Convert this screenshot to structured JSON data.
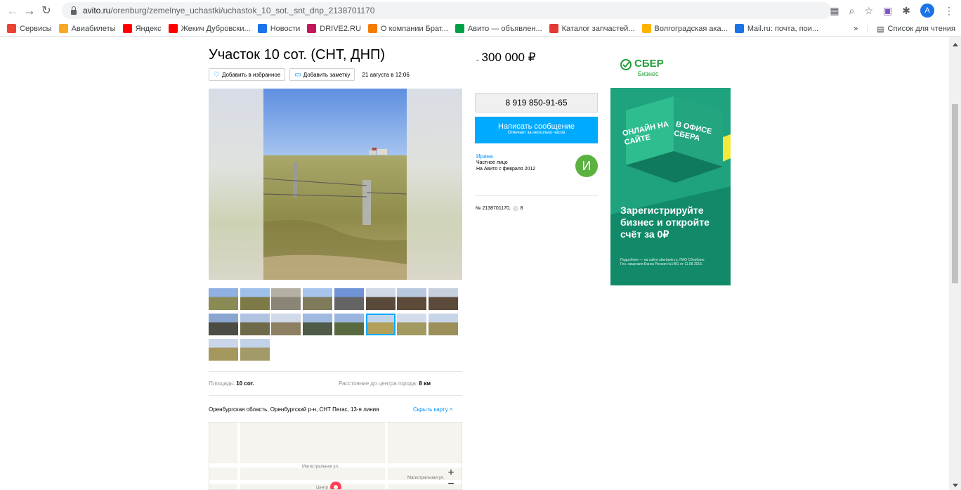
{
  "browser": {
    "url_host": "avito.ru",
    "url_path": "/orenburg/zemelnye_uchastki/uchastok_10_sot._snt_dnp_2138701170",
    "profile_initial": "A",
    "bookmarks": [
      {
        "label": "Сервисы",
        "color": "#ea4335"
      },
      {
        "label": "Авиабилеты",
        "color": "#f9a825"
      },
      {
        "label": "Яндекс",
        "color": "#ff0000"
      },
      {
        "label": "Жекич Дубровски...",
        "color": "#ff0000"
      },
      {
        "label": "Новости",
        "color": "#1a73e8"
      },
      {
        "label": "DRIVE2.RU",
        "color": "#c2185b"
      },
      {
        "label": "О компании Брат...",
        "color": "#f57c00"
      },
      {
        "label": "Авито — объявлен...",
        "color": "#00a046"
      },
      {
        "label": "Каталог запчастей...",
        "color": "#e53935"
      },
      {
        "label": "Волгоградская ака...",
        "color": "#ffb300"
      },
      {
        "label": "Mail.ru: почта, пои...",
        "color": "#1a73e8"
      }
    ],
    "bookmarks_more": "»",
    "reading_list": "Список для чтения"
  },
  "listing": {
    "title": "Участок 10 сот. (СНТ, ДНП)",
    "add_favorite": "Добавить в избранное",
    "add_note": "Добавить заметку",
    "date": "21 августа в 12:06",
    "price": "300 000 ₽",
    "phone": "8 919 850-91-65",
    "message_button": "Написать сообщение",
    "message_subtext": "Отвечает за несколько часов",
    "seller_name": "Ирина",
    "seller_type": "Частное лицо",
    "seller_since": "На Авито с февраля 2012",
    "seller_initial": "И",
    "item_id": "№ 2138701170,",
    "views": "8",
    "area_label": "Площадь:",
    "area_value": "10 сот.",
    "distance_label": "Расстояние до центра города:",
    "distance_value": "8 км",
    "address": "Оренбургская область, Оренбургский р-н, СНТ Пегас, 13-я линия",
    "hide_map": "Скрыть карту",
    "map_labels": [
      "Магистральная ул.",
      "Магистральная ул.",
      "Центр"
    ]
  },
  "ad": {
    "brand": "СБЕР",
    "brand_sub": "Бизнес",
    "cube_left": "ОНЛАЙН НА САЙТЕ",
    "cube_right": "В ОФИСЕ СБЕРА",
    "headline": "Зарегистрируйте бизнес и откройте счёт за 0₽",
    "fineprint": "Подробнее — на сайте sberbank.ru. ПАО Сбербанк. Ген. лицензия Банка России №1481 от 11.08.2015."
  }
}
